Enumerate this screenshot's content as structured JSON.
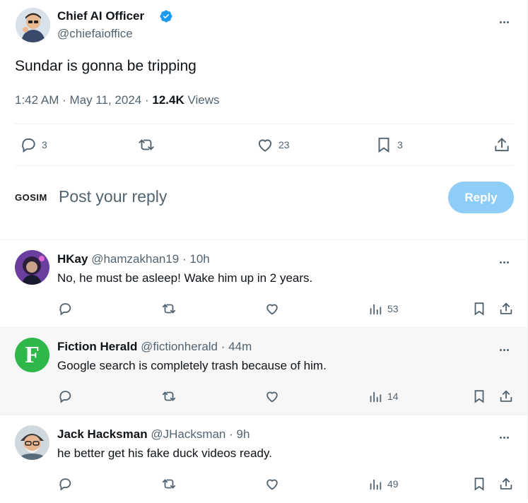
{
  "tweet": {
    "author_name": "Chief AI Officer",
    "author_handle": "@chiefaioffice",
    "text": "Sundar is gonna be tripping",
    "time": "1:42 AM",
    "date": "May 11, 2024",
    "views_count": "12.4K",
    "views_label": "Views",
    "replies": "3",
    "reposts": "",
    "likes": "23",
    "bookmarks": "3"
  },
  "compose": {
    "brand": "GOSIM",
    "placeholder": "Post your reply",
    "button": "Reply"
  },
  "replies": [
    {
      "name": "HKay",
      "handle": "@hamzakhan19",
      "time": "10h",
      "text": "No, he must be asleep! Wake him up in 2 years.",
      "views": "53"
    },
    {
      "name": "Fiction Herald",
      "handle": "@fictionherald",
      "time": "44m",
      "text": "Google search is completely trash because of him.",
      "views": "14",
      "avatar_letter": "F"
    },
    {
      "name": "Jack Hacksman",
      "handle": "@JHacksman",
      "time": "9h",
      "text": "he better get his fake duck videos ready.",
      "views": "49"
    }
  ],
  "colors": {
    "accent": "#1d9bf0",
    "reply_button": "#8ecdf7",
    "secondary_text": "#536471",
    "fiction_herald_green": "#2fb84a"
  }
}
